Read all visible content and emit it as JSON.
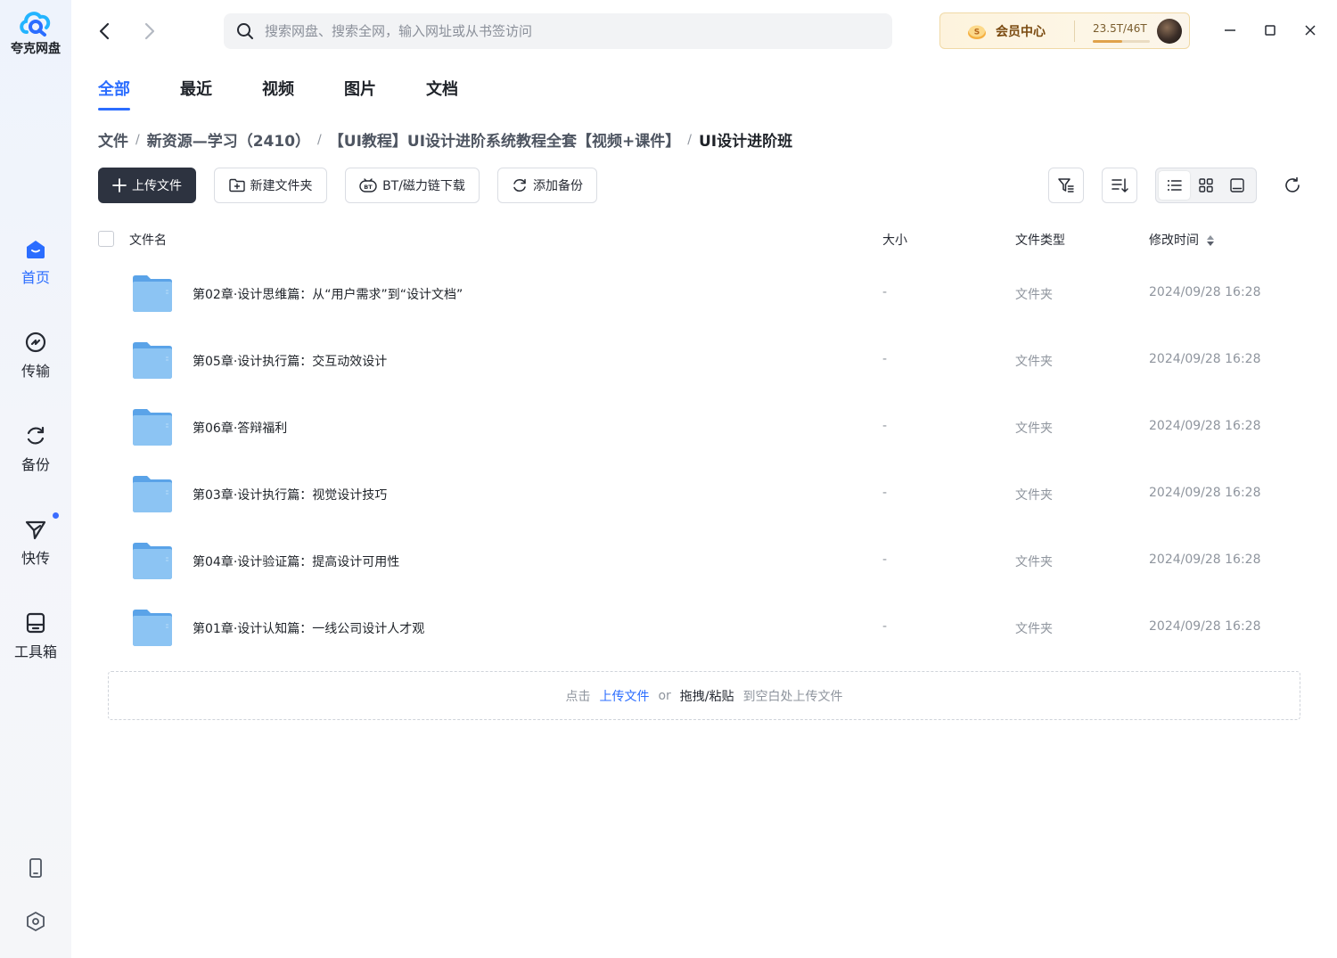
{
  "app": {
    "name": "夸克网盘"
  },
  "sidebar": {
    "items": [
      {
        "label": "首页",
        "icon": "home-icon",
        "active": true
      },
      {
        "label": "传输",
        "icon": "transfer-icon"
      },
      {
        "label": "备份",
        "icon": "backup-icon"
      },
      {
        "label": "快传",
        "icon": "quick-send-icon",
        "badge": true
      },
      {
        "label": "工具箱",
        "icon": "toolbox-icon"
      }
    ],
    "bottom": [
      "phone-icon",
      "settings-icon"
    ]
  },
  "header": {
    "search_placeholder": "搜索网盘、搜索全网，输入网址或从书签访问",
    "member_label": "会员中心",
    "quota_text": "23.5T/46T",
    "quota_fraction": 0.51
  },
  "tabs": [
    {
      "label": "全部",
      "active": true
    },
    {
      "label": "最近"
    },
    {
      "label": "视频"
    },
    {
      "label": "图片"
    },
    {
      "label": "文档"
    }
  ],
  "breadcrumb": [
    "文件",
    "新资源—学习（2410）",
    "【UI教程】UI设计进阶系统教程全套【视频+课件】",
    "UI设计进阶班"
  ],
  "toolbar": {
    "upload": "上传文件",
    "new_folder": "新建文件夹",
    "bt_download": "BT/磁力链下载",
    "add_backup": "添加备份"
  },
  "table": {
    "columns": [
      "文件名",
      "大小",
      "文件类型",
      "修改时间"
    ],
    "rows": [
      {
        "name": "第02章·设计思维篇：从“用户需求”到“设计文档”",
        "size": "-",
        "type": "文件夹",
        "modified": "2024/09/28 16:28"
      },
      {
        "name": "第05章·设计执行篇：交互动效设计",
        "size": "-",
        "type": "文件夹",
        "modified": "2024/09/28 16:28"
      },
      {
        "name": "第06章·答辩福利",
        "size": "-",
        "type": "文件夹",
        "modified": "2024/09/28 16:28"
      },
      {
        "name": "第03章·设计执行篇：视觉设计技巧",
        "size": "-",
        "type": "文件夹",
        "modified": "2024/09/28 16:28"
      },
      {
        "name": "第04章·设计验证篇：提高设计可用性",
        "size": "-",
        "type": "文件夹",
        "modified": "2024/09/28 16:28"
      },
      {
        "name": "第01章·设计认知篇：一线公司设计人才观",
        "size": "-",
        "type": "文件夹",
        "modified": "2024/09/28 16:28"
      }
    ]
  },
  "dropzone": {
    "prefix": "点击",
    "link": "上传文件",
    "or": "or",
    "drag": "拖拽/粘贴",
    "suffix": "到空白处上传文件"
  },
  "colors": {
    "accent": "#2b6dff",
    "primary_button": "#2d3340",
    "folder": "#7fb8ef"
  }
}
